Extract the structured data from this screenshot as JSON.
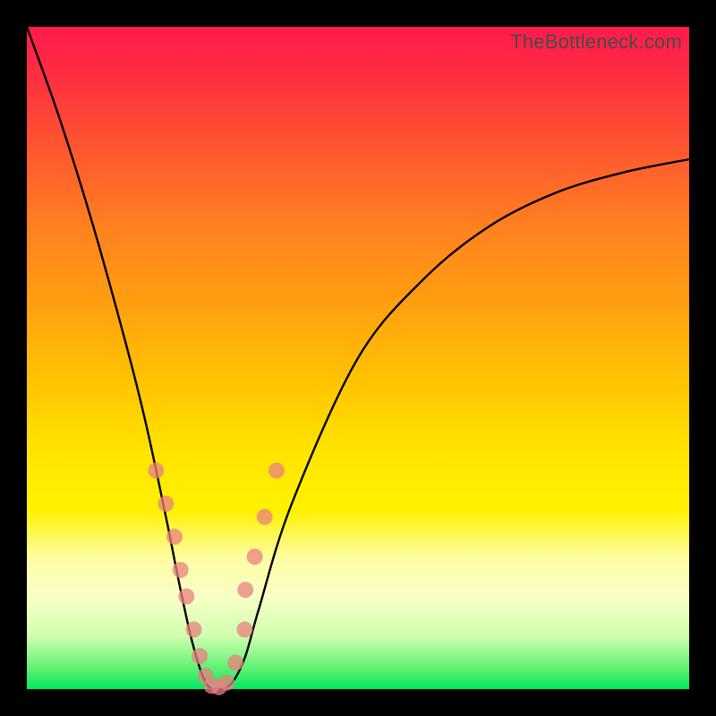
{
  "watermark": "TheBottleneck.com",
  "chart_data": {
    "type": "line",
    "title": "",
    "xlabel": "",
    "ylabel": "",
    "xlim": [
      0,
      1
    ],
    "ylim": [
      0,
      1
    ],
    "series": [
      {
        "name": "bottleneck-curve",
        "color": "#000000",
        "x": [
          0.0,
          0.05,
          0.1,
          0.15,
          0.18,
          0.21,
          0.23,
          0.25,
          0.27,
          0.29,
          0.31,
          0.33,
          0.35,
          0.4,
          0.5,
          0.6,
          0.7,
          0.8,
          0.9,
          1.0
        ],
        "values": [
          1.0,
          0.86,
          0.7,
          0.52,
          0.4,
          0.26,
          0.16,
          0.07,
          0.01,
          0.0,
          0.01,
          0.05,
          0.12,
          0.28,
          0.5,
          0.62,
          0.7,
          0.75,
          0.78,
          0.8
        ]
      }
    ],
    "markers": {
      "name": "highlight-points",
      "color": "#e88080",
      "radius_px": 9,
      "x": [
        0.195,
        0.21,
        0.223,
        0.232,
        0.241,
        0.252,
        0.261,
        0.27,
        0.279,
        0.29,
        0.302,
        0.315,
        0.329,
        0.33,
        0.344,
        0.359,
        0.377
      ],
      "y": [
        0.33,
        0.28,
        0.23,
        0.18,
        0.14,
        0.09,
        0.05,
        0.02,
        0.005,
        0.003,
        0.01,
        0.04,
        0.09,
        0.15,
        0.2,
        0.26,
        0.33
      ]
    },
    "gradient_bands": [
      {
        "pos": 0.0,
        "color": "#ff1a4d"
      },
      {
        "pos": 0.55,
        "color": "#ffc800"
      },
      {
        "pos": 0.8,
        "color": "#fdfda0"
      },
      {
        "pos": 1.0,
        "color": "#00e860"
      }
    ]
  }
}
